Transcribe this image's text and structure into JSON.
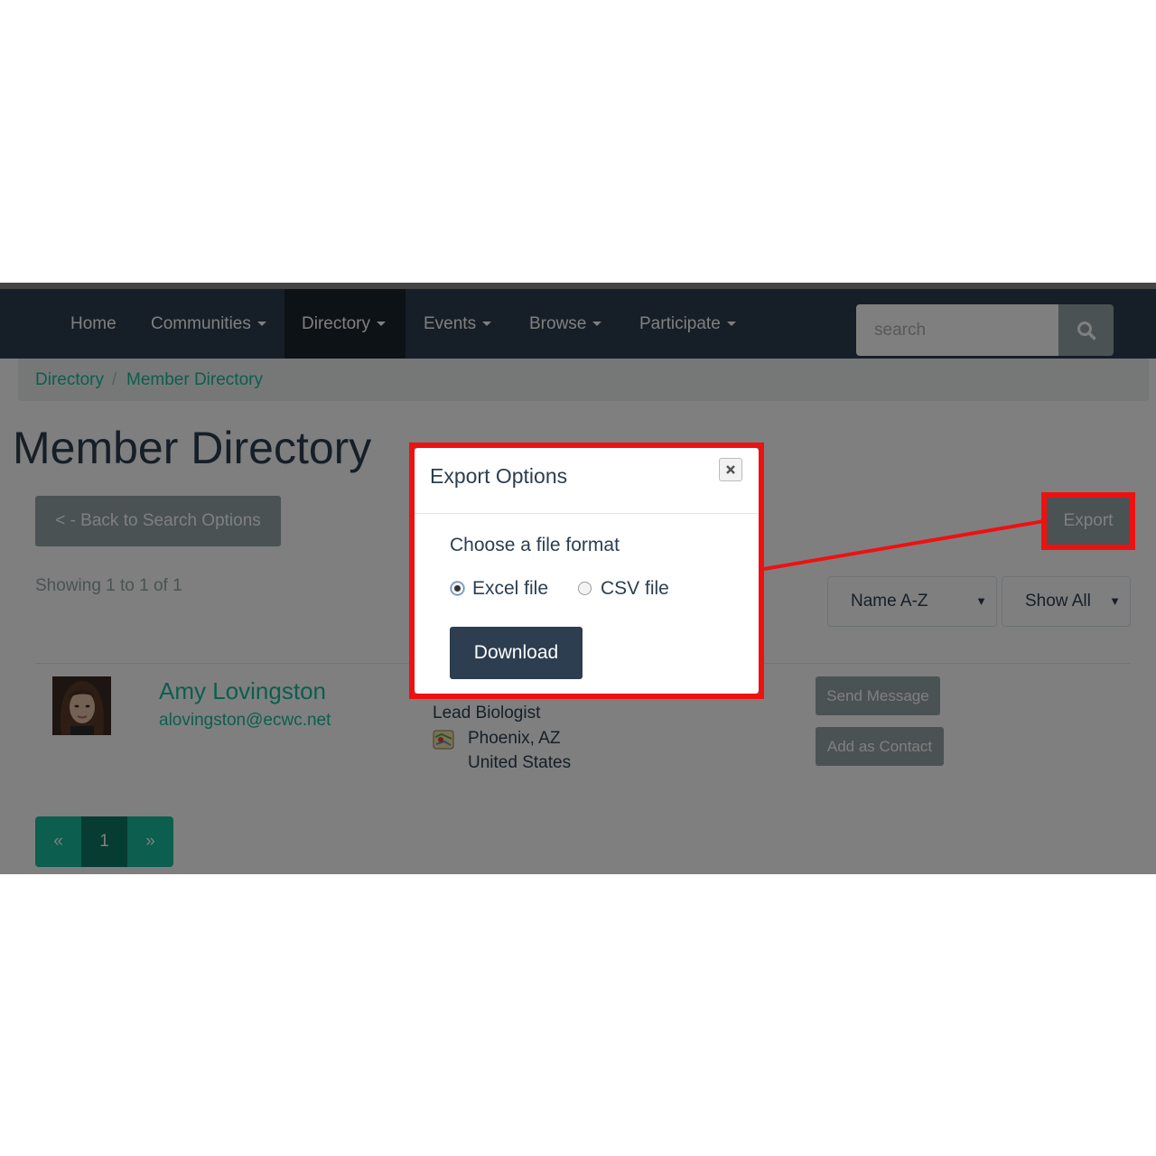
{
  "nav": {
    "items": [
      {
        "label": "Home",
        "dropdown": false
      },
      {
        "label": "Communities",
        "dropdown": true
      },
      {
        "label": "Directory",
        "dropdown": true,
        "active": true
      },
      {
        "label": "Events",
        "dropdown": true
      },
      {
        "label": "Browse",
        "dropdown": true
      },
      {
        "label": "Participate",
        "dropdown": true
      }
    ],
    "search_placeholder": "search"
  },
  "breadcrumb": [
    "Directory",
    "Member Directory"
  ],
  "page": {
    "title": "Member Directory",
    "back_button": "< - Back to Search Options",
    "export_button": "Export",
    "showing": "Showing 1 to 1 of 1",
    "sort_select": "Name A-Z",
    "show_select": "Show All"
  },
  "member": {
    "name": "Amy Lovingston",
    "email": "alovingston@ecwc.net",
    "role": "Lead Biologist",
    "city": "Phoenix, AZ",
    "country": "United States",
    "send_message": "Send Message",
    "add_contact": "Add as Contact"
  },
  "pagination": {
    "prev": "«",
    "current": "1",
    "next": "»"
  },
  "modal": {
    "title": "Export Options",
    "prompt": "Choose a file format",
    "options": [
      {
        "label": "Excel file",
        "checked": true
      },
      {
        "label": "CSV file",
        "checked": false
      }
    ],
    "download": "Download"
  },
  "colors": {
    "navbar": "#2c3e50",
    "accent": "#18bc9c",
    "muted_button": "#95a5a6",
    "highlight": "#ee1111"
  }
}
